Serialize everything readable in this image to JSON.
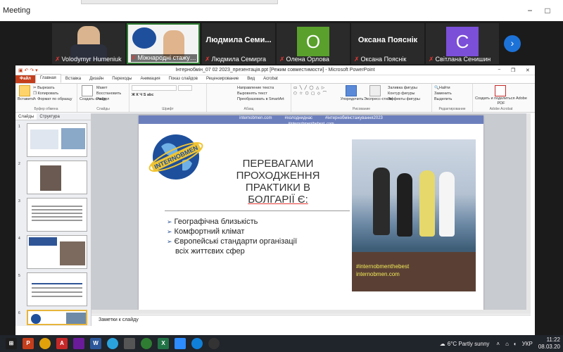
{
  "meeting": {
    "title": "Meeting",
    "controls": {
      "minimize": "−",
      "maximize": "□",
      "close": "✕"
    }
  },
  "participants": [
    {
      "name": "Volodymyr Humeniuk",
      "big": "",
      "avatar": "",
      "color": "#6a5a4a",
      "muted": true
    },
    {
      "name": "Міжнародні стажування...",
      "big": "",
      "avatar": "",
      "color": "#f3f3f3",
      "muted": true
    },
    {
      "name": "Людмила Семирга",
      "big": "Людмила Семи...",
      "avatar": "",
      "color": "#2a2a2a",
      "muted": true
    },
    {
      "name": "Олена Орлова",
      "big": "",
      "avatar": "O",
      "color": "#5aa02c",
      "muted": true
    },
    {
      "name": "Оксана Пояснік",
      "big": "Оксана Пояснік",
      "avatar": "",
      "color": "#2a2a2a",
      "muted": true
    },
    {
      "name": "Світлана Сенишин",
      "big": "",
      "avatar": "C",
      "color": "#7b4fd8",
      "muted": true
    }
  ],
  "ppt": {
    "title": "Інтернобмін_07 02 2023_презентація.ppt [Режим совместимости] - Microsoft PowerPoint",
    "tabs": [
      "Файл",
      "Главная",
      "Вставка",
      "Дизайн",
      "Переходы",
      "Анимация",
      "Показ слайдов",
      "Рецензирование",
      "Вид",
      "Acrobat"
    ],
    "ribbon": {
      "clipboard": {
        "paste": "Вставить",
        "cut": "Вырезать",
        "copy": "Копировать",
        "format": "Формат по образцу",
        "label": "Буфер обмена"
      },
      "slides": {
        "create": "Создать слайд",
        "layout": "Макет",
        "reset": "Восстановить",
        "section": "Раздел",
        "label": "Слайды"
      },
      "font": {
        "label": "Шрифт"
      },
      "paragraph": {
        "dir": "Направление текста",
        "align": "Выровнять текст",
        "smartart": "Преобразовать в SmartArt",
        "label": "Абзац"
      },
      "drawing": {
        "arrange": "Упорядочить",
        "styles": "Экспресс-стили",
        "fill": "Заливка фигуры",
        "outline": "Контур фигуры",
        "effects": "Эффекты фигуры",
        "label": "Рисование"
      },
      "editing": {
        "find": "Найти",
        "replace": "Заменить",
        "select": "Выделить",
        "label": "Редактирование"
      },
      "acrobat": {
        "create": "Создать и поделиться Adobe PDF",
        "label": "Adobe Acrobat"
      }
    },
    "pane_tabs": [
      "Слайды",
      "Структура"
    ],
    "thumbnails": [
      {
        "num": "1"
      },
      {
        "num": "2"
      },
      {
        "num": "3"
      },
      {
        "num": "4"
      },
      {
        "num": "5"
      },
      {
        "num": "6"
      }
    ],
    "notes_placeholder": "Заметки к слайду"
  },
  "slide": {
    "top_links": [
      "internobmen.com",
      "#холодниднас",
      "#інтернобмінстажування2023"
    ],
    "top_link2": "#internobmenthebest_com",
    "logo_text": "INTERNOBMEN",
    "heading": [
      "ПЕРЕВАГАМИ",
      "ПРОХОДЖЕННЯ",
      "ПРАКТИКИ В",
      "БОЛГАРІЇ Є:"
    ],
    "bullets": [
      "Географічна близькість",
      "Комфортний клімат",
      "Європейські стандарти організації",
      "всіх життєвих сфер"
    ],
    "photo_tags": [
      "#internobmenthebest",
      "internobmen.com"
    ]
  },
  "taskbar": {
    "apps": [
      {
        "name": "windows-start-icon",
        "label": "",
        "color": "#1d1d1d"
      },
      {
        "name": "powerpoint-icon",
        "label": "P",
        "color": "#c43e1c"
      },
      {
        "name": "chrome-icon",
        "label": "",
        "color": "#e0a10b"
      },
      {
        "name": "pdf-icon",
        "label": "A",
        "color": "#c62828"
      },
      {
        "name": "archive-icon",
        "label": "",
        "color": "#6a1b9a"
      },
      {
        "name": "word-icon",
        "label": "W",
        "color": "#2b579a"
      },
      {
        "name": "telegram-icon",
        "label": "",
        "color": "#2aa3dd"
      },
      {
        "name": "calculator-icon",
        "label": "",
        "color": "#555"
      },
      {
        "name": "chrome2-icon",
        "label": "",
        "color": "#2e7d32"
      },
      {
        "name": "excel-icon",
        "label": "X",
        "color": "#217346"
      },
      {
        "name": "zoom-icon",
        "label": "",
        "color": "#2d8cff"
      },
      {
        "name": "edge-icon",
        "label": "",
        "color": "#0f7fd8"
      },
      {
        "name": "obs-icon",
        "label": "",
        "color": "#333"
      }
    ],
    "weather": "6°C  Partly sunny",
    "lang": "УКР",
    "time": "11:22",
    "date": "08.03.20"
  }
}
